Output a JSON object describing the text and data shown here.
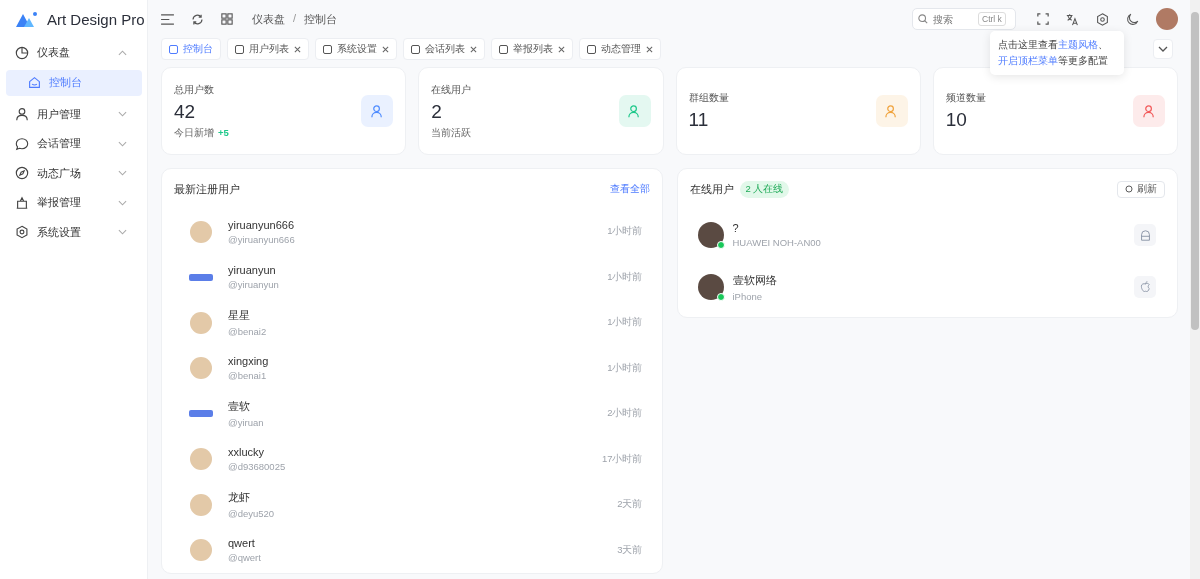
{
  "app": {
    "title": "Art Design Pro"
  },
  "sidebar": {
    "items": [
      {
        "label": "仪表盘",
        "expanded": true,
        "children": [
          {
            "label": "控制台",
            "selected": true
          }
        ]
      },
      {
        "label": "用户管理",
        "expanded": false
      },
      {
        "label": "会话管理",
        "expanded": false
      },
      {
        "label": "动态广场",
        "expanded": false
      },
      {
        "label": "举报管理",
        "expanded": false
      },
      {
        "label": "系统设置",
        "expanded": false
      }
    ]
  },
  "header": {
    "breadcrumb": [
      "仪表盘",
      "控制台"
    ],
    "separator": "/",
    "search": {
      "placeholder": "搜索",
      "shortcut": "Ctrl k"
    }
  },
  "tooltip": {
    "parts": [
      {
        "text": "点击这里查看",
        "link": false
      },
      {
        "text": "主题风格",
        "link": true
      },
      {
        "text": "、",
        "link": false
      },
      {
        "text": "开启顶栏菜单",
        "link": true
      },
      {
        "text": "等更多配置",
        "link": false
      }
    ]
  },
  "tabs": [
    {
      "label": "控制台",
      "selected": true,
      "closable": false
    },
    {
      "label": "用户列表",
      "selected": false,
      "closable": true
    },
    {
      "label": "系统设置",
      "selected": false,
      "closable": true
    },
    {
      "label": "会话列表",
      "selected": false,
      "closable": true
    },
    {
      "label": "举报列表",
      "selected": false,
      "closable": true
    },
    {
      "label": "动态管理",
      "selected": false,
      "closable": true
    }
  ],
  "stats": [
    {
      "label": "总用户数",
      "value": "42",
      "note": "今日新增",
      "delta": "+5",
      "color": "#4f8cff"
    },
    {
      "label": "在线用户",
      "value": "2",
      "note": "当前活跃",
      "color": "#1ec88a"
    },
    {
      "label": "群组数量",
      "value": "11",
      "color": "#f0a33d"
    },
    {
      "label": "频道数量",
      "value": "10",
      "color": "#f25a5a"
    }
  ],
  "recent_users": {
    "title": "最新注册用户",
    "view_all": "查看全部",
    "rows": [
      {
        "name": "yiruanyun666",
        "handle": "@yiruanyun666",
        "time": "1小时前",
        "kind": "person"
      },
      {
        "name": "yiruanyun",
        "handle": "@yiruanyun",
        "time": "1小时前",
        "kind": "logo"
      },
      {
        "name": "星星",
        "handle": "@benai2",
        "time": "1小时前",
        "kind": "person"
      },
      {
        "name": "xingxing",
        "handle": "@benai1",
        "time": "1小时前",
        "kind": "person"
      },
      {
        "name": "壹软",
        "handle": "@yiruan",
        "time": "2小时前",
        "kind": "logo"
      },
      {
        "name": "xxlucky",
        "handle": "@d93680025",
        "time": "17小时前",
        "kind": "person"
      },
      {
        "name": "龙虾",
        "handle": "@deyu520",
        "time": "2天前",
        "kind": "person"
      },
      {
        "name": "qwert",
        "handle": "@qwert",
        "time": "3天前",
        "kind": "person"
      }
    ]
  },
  "online_users": {
    "title": "在线用户",
    "badge": "2 人在线",
    "refresh": "刷新",
    "rows": [
      {
        "name": "?",
        "device": "HUAWEI NOH-AN00",
        "online": true,
        "kind": "android"
      },
      {
        "name": "壹软网络",
        "device": "iPhone",
        "online": true,
        "kind": "apple"
      }
    ]
  }
}
